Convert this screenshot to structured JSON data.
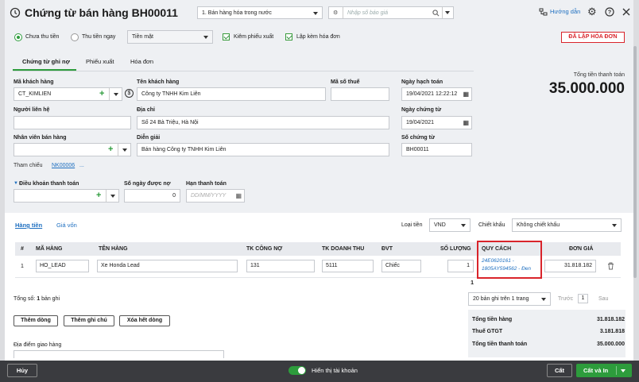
{
  "header": {
    "title": "Chứng từ bán hàng BH00011",
    "sale_type": "1. Bán hàng hóa trong nước",
    "search_placeholder": "Nhập số báo giá",
    "help_label": "Hướng dẫn"
  },
  "options": {
    "unpaid_label": "Chưa thu tiền",
    "paid_label": "Thu tiền ngay",
    "payment_method": "Tiền mặt",
    "export_slip_label": "Kiêm phiếu xuất",
    "invoice_label": "Lập kèm hóa đơn",
    "invoice_status": "ĐÃ LẬP HÓA ĐƠN"
  },
  "tabs": [
    "Chứng từ ghi nợ",
    "Phiếu xuất",
    "Hóa đơn"
  ],
  "form": {
    "customer_code_label": "Mã khách hàng",
    "customer_code": "CT_KIMLIEN",
    "customer_name_label": "Tên khách hàng",
    "customer_name": "Công ty TNHH Kim Liên",
    "tax_code_label": "Mã số thuế",
    "tax_code": "",
    "contact_label": "Người liên hệ",
    "contact": "",
    "address_label": "Địa chỉ",
    "address": "Số 24 Bà Triệu, Hà Nội",
    "salesperson_label": "Nhân viên bán hàng",
    "salesperson": "",
    "description_label": "Diễn giải",
    "description": "Bán hàng Công ty TNHH Kim Liên",
    "reference_label": "Tham chiếu",
    "reference_value": "NK00006",
    "reference_more": "...",
    "payment_terms_label": "Điều khoản thanh toán",
    "payment_terms": "",
    "credit_days_label": "Số ngày được nợ",
    "credit_days": "0",
    "due_date_label": "Hạn thanh toán",
    "due_date_placeholder": "DD/MM/YYYY",
    "posting_date_label": "Ngày hạch toán",
    "posting_date": "19/04/2021 12:22:12",
    "doc_date_label": "Ngày chứng từ",
    "doc_date": "19/04/2021",
    "doc_no_label": "Số chứng từ",
    "doc_no": "BH00011"
  },
  "total": {
    "label": "Tổng tiền thanh toán",
    "value": "35.000.000"
  },
  "detail": {
    "tab_goods": "Hàng tiền",
    "tab_cost": "Giá vốn",
    "currency_label": "Loại tiền",
    "currency": "VND",
    "discount_label": "Chiết khấu",
    "discount": "Không chiết khấu"
  },
  "table": {
    "headers": [
      "#",
      "MÃ HÀNG",
      "TÊN HÀNG",
      "TK CÔNG NỢ",
      "TK DOANH THU",
      "ĐVT",
      "SỐ LƯỢNG",
      "QUY CÁCH",
      "ĐƠN GIÁ"
    ],
    "rows": [
      {
        "no": "1",
        "code": "HO_LEAD",
        "name": "Xe Honda Lead",
        "debt_acc": "131",
        "rev_acc": "5111",
        "unit": "Chiếc",
        "qty": "1",
        "spec": "24E0620161 - 1805AY594562 - Đen",
        "price": "31.818.182"
      }
    ],
    "qty_total": "1"
  },
  "footer": {
    "record_count_label": "Tổng số:",
    "record_count": "1",
    "record_unit": "bản ghi",
    "page_size": "20 bản ghi trên 1 trang",
    "prev": "Trước",
    "page": "1",
    "next": "Sau",
    "add_row": "Thêm dòng",
    "add_note": "Thêm ghi chú",
    "delete_all": "Xóa hết dòng",
    "delivery_label": "Địa điểm giao hàng"
  },
  "summary": {
    "goods_label": "Tổng tiền hàng",
    "goods_value": "31.818.182",
    "vat_label": "Thuế GTGT",
    "vat_value": "3.181.818",
    "total_label": "Tổng tiền thanh toán",
    "total_value": "35.000.000"
  },
  "bottom": {
    "cancel": "Hủy",
    "toggle_label": "Hiển thị tài khoản",
    "save": "Cất",
    "save_print": "Cất và In"
  },
  "colors": {
    "accent": "#2d9c3c",
    "highlight": "#d9242b",
    "link": "#1e6fc0"
  }
}
